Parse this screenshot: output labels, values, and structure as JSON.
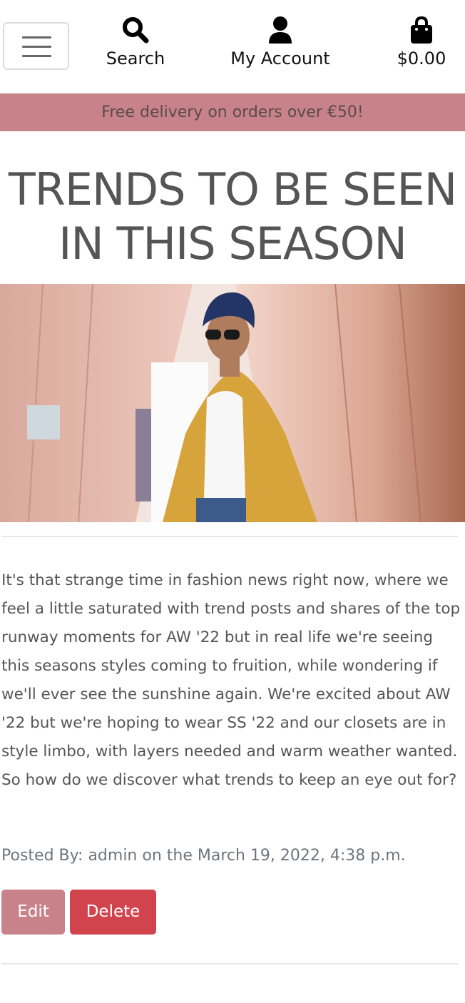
{
  "header": {
    "search_label": "Search",
    "account_label": "My Account",
    "bag_total": "$0.00",
    "icons": {
      "menu": "hamburger-icon",
      "search": "search-icon",
      "account": "user-icon",
      "bag": "shopping-bag-icon"
    }
  },
  "banner": {
    "text": "Free delivery on orders over €50!"
  },
  "post": {
    "title_line1": "TRENDS TO BE SEEN",
    "title_line2": "IN THIS SEASON",
    "body": "It's that strange time in fashion news right now, where we feel a little saturated with trend posts and shares of the top runway moments for AW '22 but in real life we're seeing this seasons styles coming to fruition, while wondering if we'll ever see the sunshine again. We're excited about AW '22 but we're hoping to wear SS '22 and our closets are in style limbo, with layers needed and warm weather wanted. So how do we discover what trends to keep an eye out for?",
    "meta": "Posted By: admin on the March 19, 2022, 4:38 p.m.",
    "edit_label": "Edit",
    "delete_label": "Delete"
  },
  "colors": {
    "banner_bg": "#c8838a",
    "edit_bg": "#c8838a",
    "delete_bg": "#d1434d",
    "text": "#555555"
  }
}
